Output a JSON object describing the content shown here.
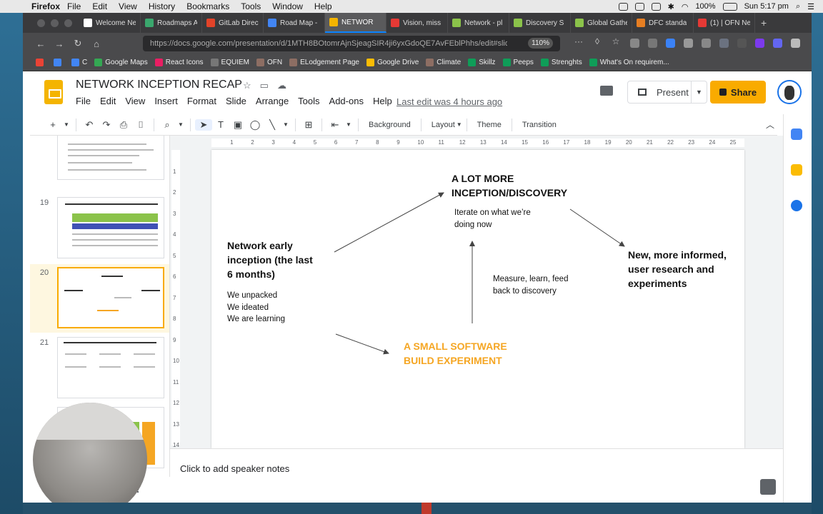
{
  "menubar": {
    "app": "Firefox",
    "items": [
      "File",
      "Edit",
      "View",
      "History",
      "Bookmarks",
      "Tools",
      "Window",
      "Help"
    ],
    "battery": "100%",
    "clock": "Sun 5:17 pm"
  },
  "tabs": [
    {
      "label": "Welcome Ne",
      "color": "#ffffff"
    },
    {
      "label": "Roadmaps A",
      "color": "#3aa76d"
    },
    {
      "label": "GitLab Direc",
      "color": "#e24329"
    },
    {
      "label": "Road Map -",
      "color": "#4285f4"
    },
    {
      "label": "NETWOR",
      "color": "#f4b400",
      "active": true
    },
    {
      "label": "Vision, miss",
      "color": "#e53935"
    },
    {
      "label": "Network - pl",
      "color": "#8bc34a"
    },
    {
      "label": "Discovery S",
      "color": "#8bc34a"
    },
    {
      "label": "Global Gathe",
      "color": "#8bc34a"
    },
    {
      "label": "DFC standa",
      "color": "#e67e22"
    },
    {
      "label": "(1) | OFN Ne",
      "color": "#e53935"
    }
  ],
  "nav": {
    "url": "https://docs.google.com/presentation/d/1MTH8BOtomrAjnSjeagSIR4ji6yxGdoQE7AvFEblPhhs/edit#slide",
    "zoom": "110%"
  },
  "bookmarks": [
    {
      "label": "C",
      "color": "#4285f4"
    },
    {
      "label": "Google Maps",
      "color": "#34a853"
    },
    {
      "label": "React Icons",
      "color": "#e91e63"
    },
    {
      "label": "EQUIEM",
      "color": "#777777"
    },
    {
      "label": "OFN",
      "color": "#8d6e63"
    },
    {
      "label": "ELodgement Page",
      "color": "#8d6e63"
    },
    {
      "label": "Google Drive",
      "color": "#fbbc04"
    },
    {
      "label": "Climate",
      "color": "#8d6e63"
    },
    {
      "label": "Skillz",
      "color": "#0f9d58"
    },
    {
      "label": "Peeps",
      "color": "#0f9d58"
    },
    {
      "label": "Strenghts",
      "color": "#0f9d58"
    },
    {
      "label": "What's On requirem...",
      "color": "#0f9d58"
    }
  ],
  "docs": {
    "title": "NETWORK INCEPTION RECAP",
    "menu": [
      "File",
      "Edit",
      "View",
      "Insert",
      "Format",
      "Slide",
      "Arrange",
      "Tools",
      "Add-ons",
      "Help"
    ],
    "last_edit": "Last edit was 4 hours ago",
    "present_label": "Present",
    "share_label": "Share"
  },
  "toolbar": {
    "background_label": "Background",
    "layout_label": "Layout",
    "theme_label": "Theme",
    "transition_label": "Transition"
  },
  "ruler_ticks": [
    "1",
    "2",
    "3",
    "4",
    "5",
    "6",
    "7",
    "8",
    "9",
    "10",
    "11",
    "12",
    "13",
    "14",
    "15",
    "16",
    "17",
    "18",
    "19",
    "20",
    "21",
    "22",
    "23",
    "24",
    "25"
  ],
  "vruler_ticks": [
    "1",
    "2",
    "3",
    "4",
    "5",
    "6",
    "7",
    "8",
    "9",
    "10",
    "11",
    "12",
    "13",
    "14"
  ],
  "filmstrip": [
    {
      "num": "",
      "selected": false
    },
    {
      "num": "19",
      "selected": false
    },
    {
      "num": "20",
      "selected": true
    },
    {
      "num": "21",
      "selected": false
    },
    {
      "num": "",
      "selected": false
    }
  ],
  "slide": {
    "top_heading_1": "A LOT MORE",
    "top_heading_2": "INCEPTION/DISCOVERY",
    "top_sub_1": "Iterate on what we’re",
    "top_sub_2": "doing now",
    "left_heading_1": "Network early",
    "left_heading_2": "inception (the last",
    "left_heading_3": "6 months)",
    "left_p1": "We unpacked",
    "left_p2": "We ideated",
    "left_p3": "We are learning",
    "right_heading_1": "New, more informed,",
    "right_heading_2": "user research and",
    "right_heading_3": "experiments",
    "middle_1": "Measure, learn, feed",
    "middle_2": "back to discovery",
    "bottom_heading_1": "A SMALL SOFTWARE",
    "bottom_heading_2": "BUILD EXPERIMENT",
    "accent_color": "#f5a623"
  },
  "notes": {
    "placeholder": "Click to add speaker notes"
  }
}
